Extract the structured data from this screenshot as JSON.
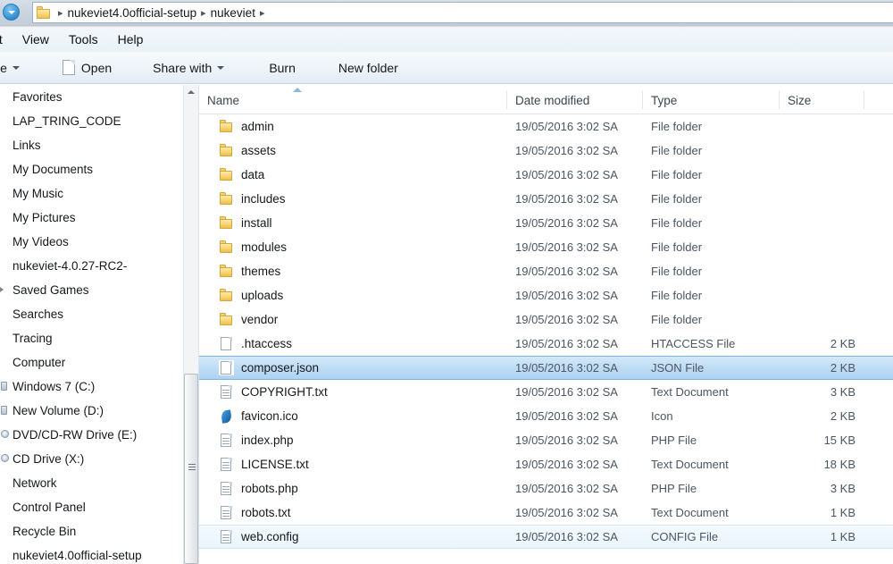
{
  "addressbar": {
    "folder_icon": "folder-icon",
    "crumbs": [
      "nukeviet4.0official-setup",
      "nukeviet"
    ],
    "separator": "▸",
    "trailing_separator": "▸"
  },
  "menubar": {
    "items": [
      "dit",
      "View",
      "Tools",
      "Help"
    ]
  },
  "toolbar": {
    "organize_label": "ize",
    "open_label": "Open",
    "share_with_label": "Share with",
    "burn_label": "Burn",
    "new_folder_label": "New folder"
  },
  "navpane": {
    "items": [
      {
        "label": "Favorites",
        "icon": "none"
      },
      {
        "label": "LAP_TRING_CODE",
        "icon": "none"
      },
      {
        "label": "Links",
        "icon": "none"
      },
      {
        "label": "My Documents",
        "icon": "none"
      },
      {
        "label": "My Music",
        "icon": "none"
      },
      {
        "label": "My Pictures",
        "icon": "none"
      },
      {
        "label": "My Videos",
        "icon": "none"
      },
      {
        "label": "nukeviet-4.0.27-RC2-",
        "icon": "none"
      },
      {
        "label": "Saved Games",
        "icon": "chevron"
      },
      {
        "label": "Searches",
        "icon": "none"
      },
      {
        "label": "Tracing",
        "icon": "none"
      },
      {
        "label": "Computer",
        "icon": "none"
      },
      {
        "label": "Windows 7 (C:)",
        "icon": "drive"
      },
      {
        "label": "New Volume (D:)",
        "icon": "drive"
      },
      {
        "label": "DVD/CD-RW Drive (E:)",
        "icon": "disc"
      },
      {
        "label": "CD Drive (X:)",
        "icon": "disc"
      },
      {
        "label": "Network",
        "icon": "none"
      },
      {
        "label": "Control Panel",
        "icon": "none"
      },
      {
        "label": "Recycle Bin",
        "icon": "none"
      },
      {
        "label": "nukeviet4.0official-setup",
        "icon": "none"
      }
    ]
  },
  "filelist": {
    "columns": [
      "Name",
      "Date modified",
      "Type",
      "Size"
    ],
    "sort_column": "Name",
    "sort_direction": "ascending",
    "rows": [
      {
        "name": "admin",
        "date": "19/05/2016 3:02 SA",
        "type": "File folder",
        "size": "",
        "icon": "folder-icon",
        "state": "normal"
      },
      {
        "name": "assets",
        "date": "19/05/2016 3:02 SA",
        "type": "File folder",
        "size": "",
        "icon": "folder-icon",
        "state": "normal"
      },
      {
        "name": "data",
        "date": "19/05/2016 3:02 SA",
        "type": "File folder",
        "size": "",
        "icon": "folder-icon",
        "state": "normal"
      },
      {
        "name": "includes",
        "date": "19/05/2016 3:02 SA",
        "type": "File folder",
        "size": "",
        "icon": "folder-icon",
        "state": "normal"
      },
      {
        "name": "install",
        "date": "19/05/2016 3:02 SA",
        "type": "File folder",
        "size": "",
        "icon": "folder-icon",
        "state": "normal"
      },
      {
        "name": "modules",
        "date": "19/05/2016 3:02 SA",
        "type": "File folder",
        "size": "",
        "icon": "folder-icon",
        "state": "normal"
      },
      {
        "name": "themes",
        "date": "19/05/2016 3:02 SA",
        "type": "File folder",
        "size": "",
        "icon": "folder-icon",
        "state": "normal"
      },
      {
        "name": "uploads",
        "date": "19/05/2016 3:02 SA",
        "type": "File folder",
        "size": "",
        "icon": "folder-icon",
        "state": "normal"
      },
      {
        "name": "vendor",
        "date": "19/05/2016 3:02 SA",
        "type": "File folder",
        "size": "",
        "icon": "folder-icon",
        "state": "normal"
      },
      {
        "name": ".htaccess",
        "date": "19/05/2016 3:02 SA",
        "type": "HTACCESS File",
        "size": "2 KB",
        "icon": "blank-file-icon",
        "state": "normal"
      },
      {
        "name": "composer.json",
        "date": "19/05/2016 3:02 SA",
        "type": "JSON File",
        "size": "2 KB",
        "icon": "blank-file-icon",
        "state": "selected"
      },
      {
        "name": "COPYRIGHT.txt",
        "date": "19/05/2016 3:02 SA",
        "type": "Text Document",
        "size": "3 KB",
        "icon": "text-file-icon",
        "state": "normal"
      },
      {
        "name": "favicon.ico",
        "date": "19/05/2016 3:02 SA",
        "type": "Icon",
        "size": "2 KB",
        "icon": "favicon-icon",
        "state": "normal"
      },
      {
        "name": "index.php",
        "date": "19/05/2016 3:02 SA",
        "type": "PHP File",
        "size": "15 KB",
        "icon": "text-file-icon",
        "state": "normal"
      },
      {
        "name": "LICENSE.txt",
        "date": "19/05/2016 3:02 SA",
        "type": "Text Document",
        "size": "18 KB",
        "icon": "text-file-icon",
        "state": "normal"
      },
      {
        "name": "robots.php",
        "date": "19/05/2016 3:02 SA",
        "type": "PHP File",
        "size": "3 KB",
        "icon": "text-file-icon",
        "state": "normal"
      },
      {
        "name": "robots.txt",
        "date": "19/05/2016 3:02 SA",
        "type": "Text Document",
        "size": "1 KB",
        "icon": "text-file-icon",
        "state": "normal"
      },
      {
        "name": "web.config",
        "date": "19/05/2016 3:02 SA",
        "type": "CONFIG File",
        "size": "1 KB",
        "icon": "text-file-icon",
        "state": "hovered"
      }
    ]
  },
  "colors": {
    "selection_fill": "#bedcf4",
    "selection_border": "#7cb6e2",
    "hover_border": "#cfe4f5",
    "folder_yellow": "#f8d679",
    "accent_blue": "#3f9bd9",
    "chrome_gray": "#cbd5e0"
  }
}
